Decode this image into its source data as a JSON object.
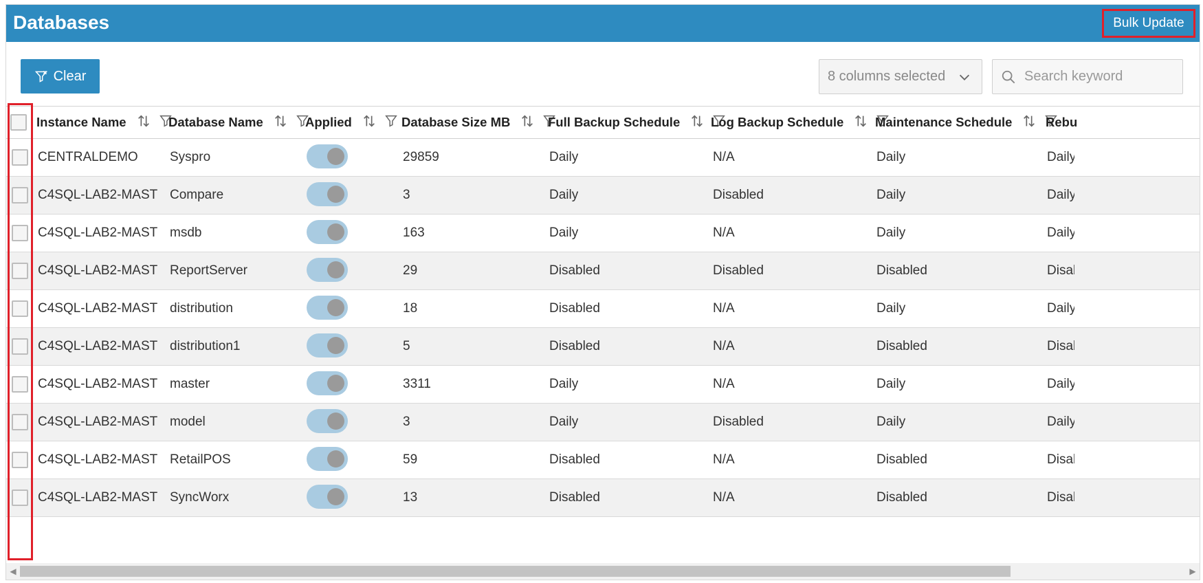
{
  "header": {
    "title": "Databases",
    "bulk_update_label": "Bulk Update"
  },
  "toolbar": {
    "clear_label": "Clear",
    "columns_selected": "8 columns selected",
    "search_placeholder": "Search keyword"
  },
  "table": {
    "columns": [
      "Instance Name",
      "Database Name",
      "Applied",
      "Database Size MB",
      "Full Backup Schedule",
      "Log Backup Schedule",
      "Maintenance Schedule",
      "Rebu"
    ],
    "rows": [
      {
        "instance": "CENTRALDEMO",
        "database": "Syspro",
        "size": "29859",
        "full": "Daily",
        "log": "N/A",
        "maint": "Daily",
        "rebuild": "Daily"
      },
      {
        "instance": "C4SQL-LAB2-MAST",
        "database": "Compare",
        "size": "3",
        "full": "Daily",
        "log": "Disabled",
        "maint": "Daily",
        "rebuild": "Daily"
      },
      {
        "instance": "C4SQL-LAB2-MAST",
        "database": "msdb",
        "size": "163",
        "full": "Daily",
        "log": "N/A",
        "maint": "Daily",
        "rebuild": "Daily"
      },
      {
        "instance": "C4SQL-LAB2-MAST",
        "database": "ReportServer",
        "size": "29",
        "full": "Disabled",
        "log": "Disabled",
        "maint": "Disabled",
        "rebuild": "Disab"
      },
      {
        "instance": "C4SQL-LAB2-MAST",
        "database": "distribution",
        "size": "18",
        "full": "Disabled",
        "log": "N/A",
        "maint": "Daily",
        "rebuild": "Daily"
      },
      {
        "instance": "C4SQL-LAB2-MAST",
        "database": "distribution1",
        "size": "5",
        "full": "Disabled",
        "log": "N/A",
        "maint": "Disabled",
        "rebuild": "Disab"
      },
      {
        "instance": "C4SQL-LAB2-MAST",
        "database": "master",
        "size": "3311",
        "full": "Daily",
        "log": "N/A",
        "maint": "Daily",
        "rebuild": "Daily"
      },
      {
        "instance": "C4SQL-LAB2-MAST",
        "database": "model",
        "size": "3",
        "full": "Daily",
        "log": "Disabled",
        "maint": "Daily",
        "rebuild": "Daily"
      },
      {
        "instance": "C4SQL-LAB2-MAST",
        "database": "RetailPOS",
        "size": "59",
        "full": "Disabled",
        "log": "N/A",
        "maint": "Disabled",
        "rebuild": "Disab"
      },
      {
        "instance": "C4SQL-LAB2-MAST",
        "database": "SyncWorx",
        "size": "13",
        "full": "Disabled",
        "log": "N/A",
        "maint": "Disabled",
        "rebuild": "Disab"
      }
    ]
  },
  "colors": {
    "header_blue": "#2e8bc0",
    "highlight_red": "#e0202a",
    "toggle_track": "#a9cbe1"
  },
  "icons": {
    "sort": "sort-icon",
    "filter": "filter-icon",
    "search": "search-icon",
    "chevron": "chevron-down-icon",
    "clear_filter": "filter-clear-icon"
  }
}
